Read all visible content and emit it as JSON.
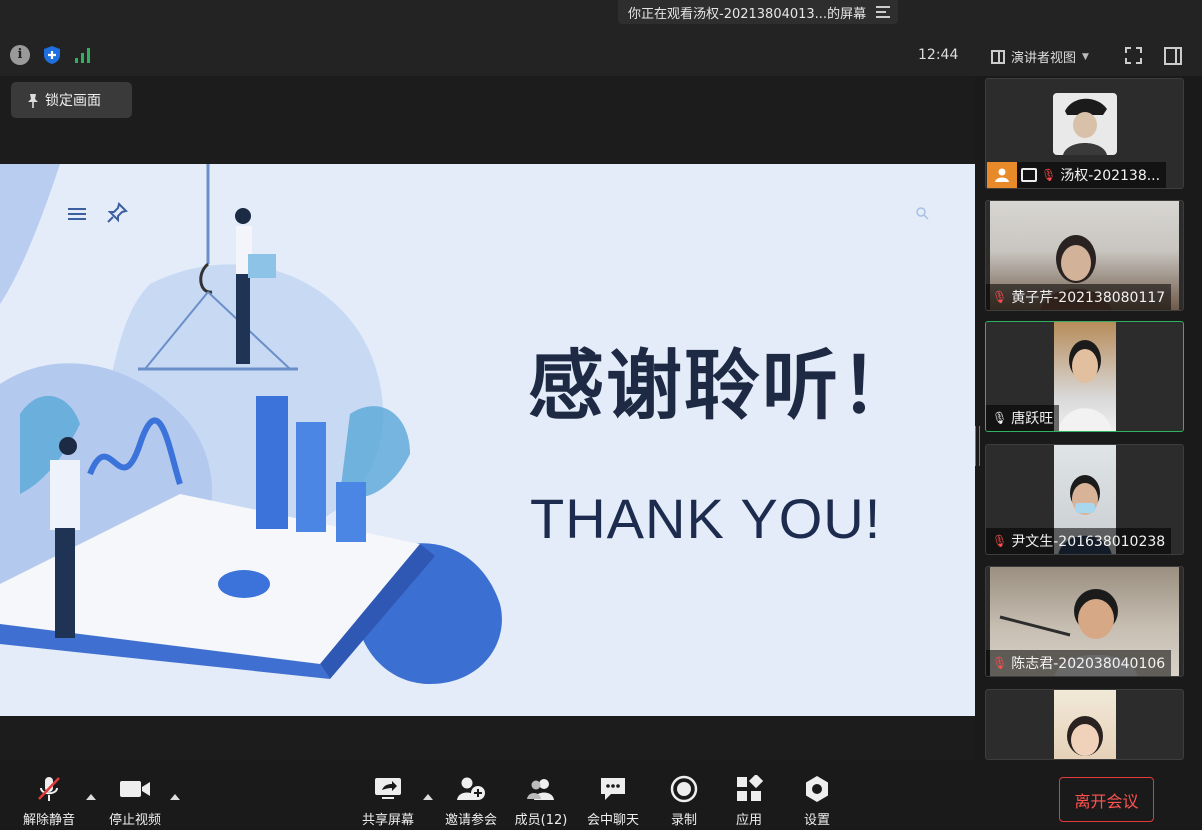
{
  "topbar": {
    "viewing_text": "你正在观看汤权-20213804013...的屏幕"
  },
  "header": {
    "time": "12:44",
    "view_mode": "演讲者视图"
  },
  "lock_button": "锁定画面",
  "slide": {
    "title": "感谢聆听！",
    "subtitle": "THANK YOU!"
  },
  "participants": [
    {
      "name": "汤权-202138...",
      "host": true,
      "sharing": true,
      "muted": true
    },
    {
      "name": "黄子芹-20213808011​7",
      "muted": true
    },
    {
      "name": "唐跃旺",
      "muted": false,
      "speaking": true
    },
    {
      "name": "尹文生-201638010238",
      "muted": true
    },
    {
      "name": "陈志君-202038040106",
      "muted": true
    },
    {
      "name": "",
      "muted": true
    }
  ],
  "toolbar": {
    "unmute": "解除静音",
    "stop_video": "停止视频",
    "share_screen": "共享屏幕",
    "invite": "邀请参会",
    "members": "成员(12)",
    "chat": "会中聊天",
    "record": "录制",
    "apps": "应用",
    "settings": "设置",
    "leave": "离开会议"
  },
  "colors": {
    "accent_green": "#2fb15f",
    "leave_red": "#e33b3b",
    "host_orange": "#e98a2a",
    "slide_bg": "#e3ecf8"
  }
}
